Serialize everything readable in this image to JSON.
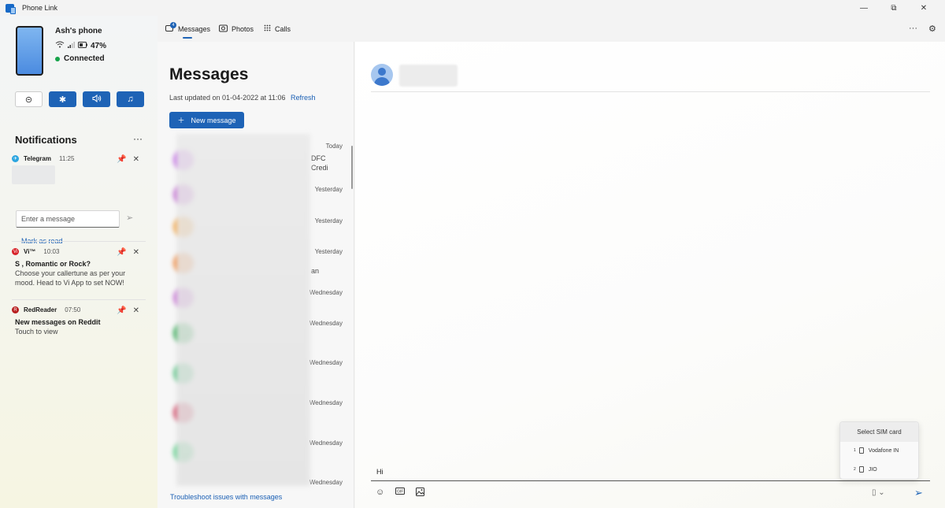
{
  "app": {
    "title": "Phone Link"
  },
  "window_buttons": [
    "—",
    "⧉",
    "✕"
  ],
  "phone": {
    "name": "Ash's phone",
    "battery": "47%",
    "status": "Connected",
    "status_color": "#16a34a"
  },
  "quick_actions": [
    {
      "icon": "do-not-disturb-icon",
      "glyph": "⊝"
    },
    {
      "icon": "bluetooth-icon",
      "glyph": "✱"
    },
    {
      "icon": "volume-icon",
      "glyph": "🔊"
    },
    {
      "icon": "music-icon",
      "glyph": "♫"
    }
  ],
  "notifications": {
    "header": "Notifications",
    "more": "···",
    "items": [
      {
        "app": "Telegram",
        "time": "11:25",
        "icon_color": "#2ca5e0",
        "icon_letter": "✈",
        "reply_placeholder": "Enter a message",
        "mark_read": "Mark as read"
      },
      {
        "app": "Vi™",
        "time": "10:03",
        "icon_color": "#d8232a",
        "icon_letter": "Vi",
        "title": "S , Romantic or Rock?",
        "body": "Choose your callertune as per your mood. Head to Vi App to set NOW!"
      },
      {
        "app": "RedReader",
        "time": "07:50",
        "icon_color": "#b71c1c",
        "icon_letter": "R",
        "title": "New messages on Reddit",
        "body": "Touch to view"
      }
    ]
  },
  "tabs": [
    {
      "label": "Messages",
      "icon": "messages-icon",
      "badge": "4"
    },
    {
      "label": "Photos",
      "icon": "photos-icon"
    },
    {
      "label": "Calls",
      "icon": "calls-icon"
    }
  ],
  "messages": {
    "title": "Messages",
    "updated": "Last updated on 01-04-2022 at 11:06",
    "refresh": "Refresh",
    "new_message": "New message",
    "troubleshoot": "Troubleshoot issues with messages",
    "rows": [
      {
        "time": "Today",
        "avatar_color": "#c77ae6",
        "frag": "DFC",
        "frag2": "Credi"
      },
      {
        "time": "Yesterday",
        "avatar_color": "#c574d4",
        "frag": ""
      },
      {
        "time": "Yesterday",
        "avatar_color": "#f3a94f",
        "frag": ""
      },
      {
        "time": "Yesterday",
        "avatar_color": "#f0904a",
        "frag": "an"
      },
      {
        "time": "Wednesday",
        "avatar_color": "#c97ad6",
        "frag": ""
      },
      {
        "time": "Wednesday",
        "avatar_color": "#3cae5c",
        "frag": ""
      },
      {
        "time": "Wednesday",
        "avatar_color": "#60c68a",
        "frag": ""
      },
      {
        "time": "Wednesday",
        "avatar_color": "#d4506d",
        "frag": ""
      },
      {
        "time": "Wednesday",
        "avatar_color": "#66d290",
        "frag": ""
      },
      {
        "time": "Wednesday",
        "avatar_color": "#e0e0e0",
        "frag": ""
      }
    ]
  },
  "conversation": {
    "compose_text": "Hi",
    "sim_menu": {
      "header": "Select SIM card",
      "options": [
        {
          "slot": "1",
          "label": "Vodafone IN"
        },
        {
          "slot": "2",
          "label": "JIO"
        }
      ]
    }
  },
  "accent_color": "#1e63b6"
}
